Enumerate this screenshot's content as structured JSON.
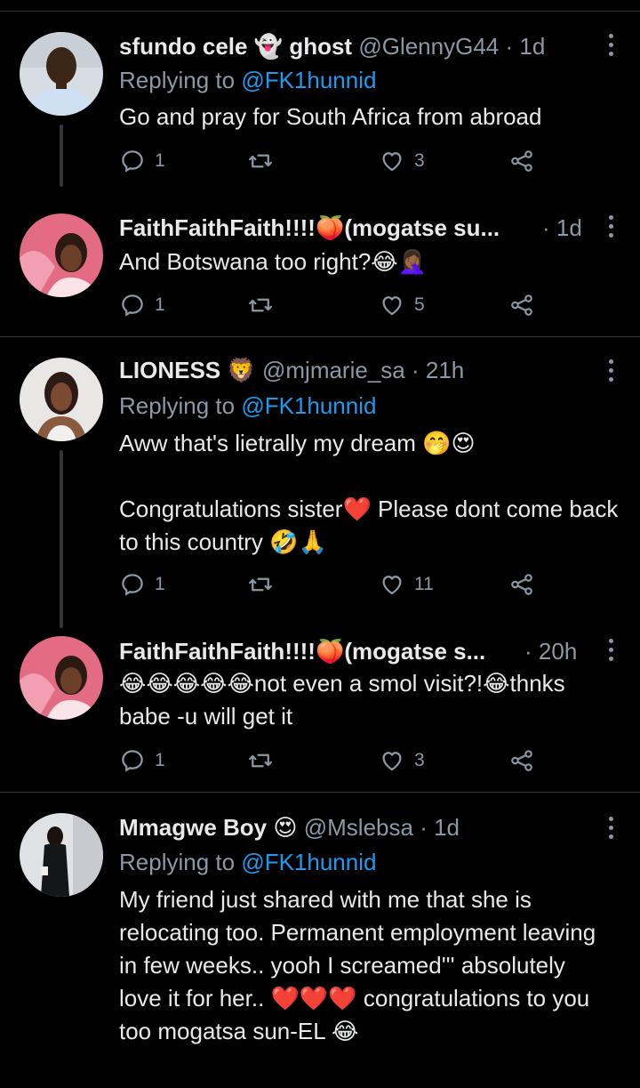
{
  "tweets": [
    {
      "name": "sfundo cele",
      "name_emoji": "👻",
      "name_suffix": "ghost",
      "handle": "@GlennyG44",
      "time": "1d",
      "reply_prefix": "Replying to",
      "reply_to": "@FK1hunnid",
      "body": "Go and pray for South Africa from abroad",
      "reply_count": "1",
      "retweet_count": "",
      "like_count": "3"
    },
    {
      "name": "FaithFaithFaith!!!!🍑(mogatse su...",
      "handle": "",
      "time": "1d",
      "body": "And Botswana too right?😂🤦🏾‍♀️",
      "reply_count": "1",
      "retweet_count": "",
      "like_count": "5"
    },
    {
      "name": "LIONESS",
      "name_emoji": "🦁",
      "handle": "@mjmarie_sa",
      "time": "21h",
      "reply_prefix": "Replying to",
      "reply_to": "@FK1hunnid",
      "body": "Aww that's lietrally my dream 🤭😍\n\nCongratulations sister❤️ Please dont come back to this country 🤣🙏",
      "reply_count": "1",
      "retweet_count": "",
      "like_count": "11"
    },
    {
      "name": "FaithFaithFaith!!!!🍑(mogatse s...",
      "handle": "",
      "time": "20h",
      "body": "😂😂😂😂😂not even a smol visit?!😂thnks babe -u will get it",
      "reply_count": "1",
      "retweet_count": "",
      "like_count": "3"
    },
    {
      "name": "Mmagwe Boy",
      "name_emoji": "😍",
      "handle": "@Mslebsa",
      "time": "1d",
      "reply_prefix": "Replying to",
      "reply_to": "@FK1hunnid",
      "body": "My friend just shared with me that she is relocating too. Permanent employment leaving in few weeks.. yooh I screamed''' absolutely love it for her.. ❤️❤️❤️ congratulations to you too mogatsa sun-EL 😂"
    }
  ],
  "colors": {
    "background": "#000000",
    "text": "#e7e9ea",
    "muted": "#8b98a5",
    "link": "#1d9bf0",
    "divider": "#2f3336"
  },
  "icons": [
    "reply-icon",
    "retweet-icon",
    "like-icon",
    "share-icon",
    "more-icon"
  ]
}
